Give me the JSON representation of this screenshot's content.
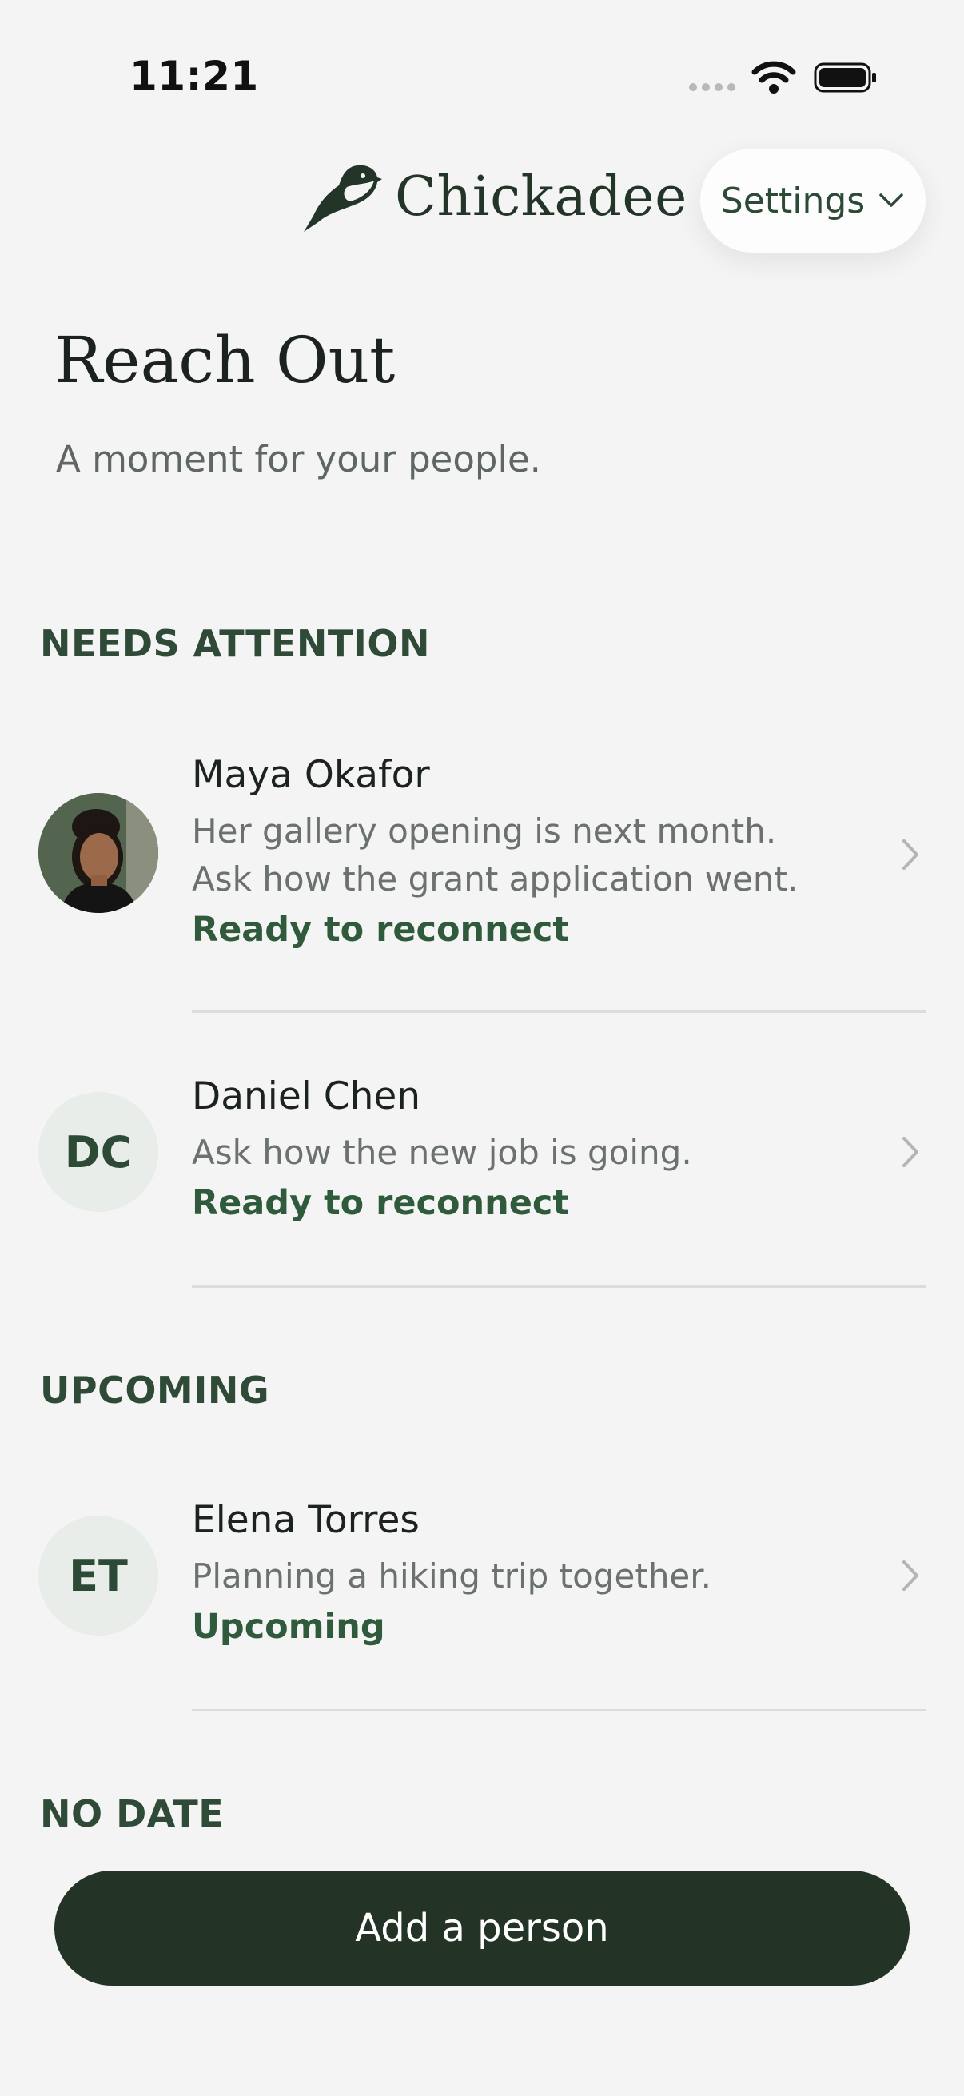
{
  "status_bar": {
    "time": "11:21",
    "signal_icon": "signal-dots-icon",
    "wifi_icon": "wifi-icon",
    "battery_icon": "battery-icon"
  },
  "header": {
    "app_name": "Chickadee",
    "logo_icon": "chickadee-bird-icon",
    "settings_label": "Settings"
  },
  "page": {
    "title": "Reach Out",
    "subtitle": "A moment for your people."
  },
  "sections": [
    {
      "label": "NEEDS ATTENTION",
      "people": [
        {
          "name": "Maya Okafor",
          "avatar": "photo",
          "notes": [
            "Her gallery opening is next month.",
            "Ask how the grant application went."
          ],
          "status": "Ready to reconnect"
        },
        {
          "name": "Daniel Chen",
          "initials": "DC",
          "notes": [
            "Ask how the new job is going."
          ],
          "status": "Ready to reconnect"
        }
      ]
    },
    {
      "label": "UPCOMING",
      "people": [
        {
          "name": "Elena Torres",
          "initials": "ET",
          "notes": [
            "Planning a hiking trip together."
          ],
          "status": "Upcoming"
        }
      ]
    },
    {
      "label": "NO DATE",
      "people": []
    }
  ],
  "actions": {
    "add_person_label": "Add a person"
  },
  "colors": {
    "accent": "#2f5a3b",
    "button": "#233325",
    "background": "#f4f4f4"
  }
}
